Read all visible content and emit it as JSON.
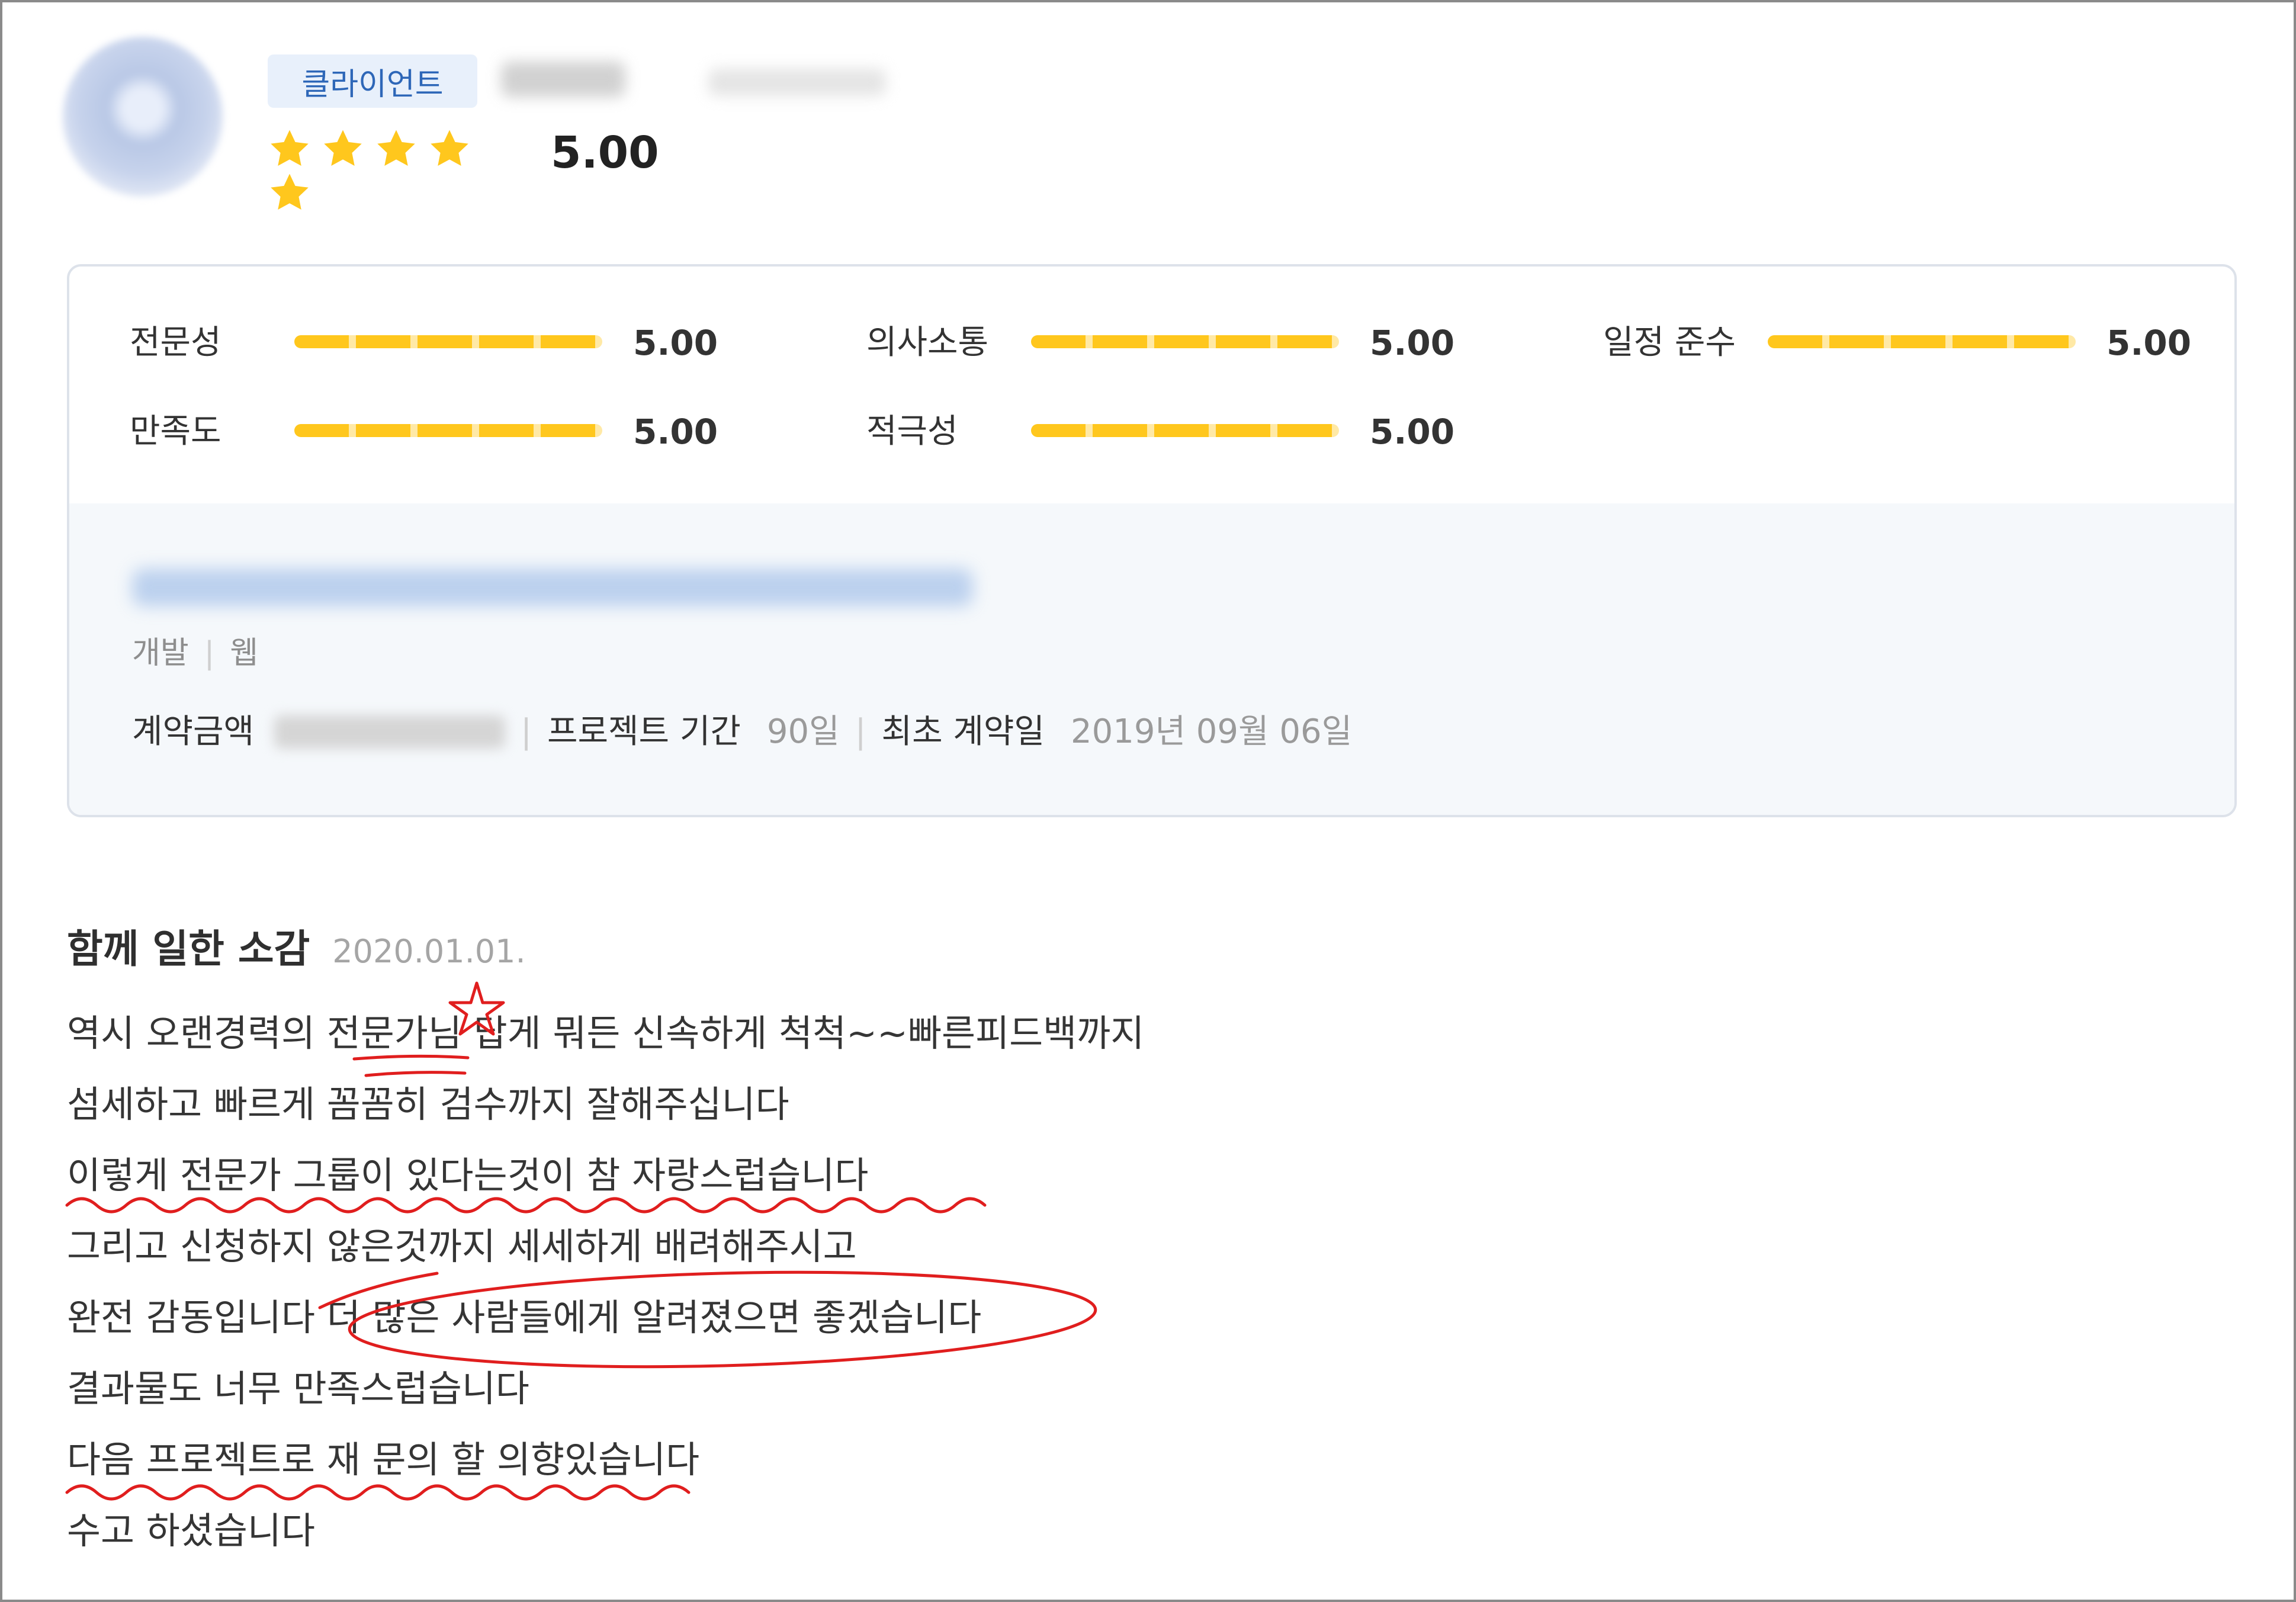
{
  "profile": {
    "role_badge": "클라이언트",
    "rating": "5.00",
    "stars_filled": 5,
    "stars_total": 5
  },
  "scores": [
    {
      "label": "전문성",
      "value": "5.00"
    },
    {
      "label": "의사소통",
      "value": "5.00"
    },
    {
      "label": "일정 준수",
      "value": "5.00"
    },
    {
      "label": "만족도",
      "value": "5.00"
    },
    {
      "label": "적극성",
      "value": "5.00"
    }
  ],
  "project": {
    "category": "개발",
    "subcategory": "웹",
    "amount_label": "계약금액",
    "period_label": "프로젝트 기간",
    "period_value": "90일",
    "first_contract_label": "최초 계약일",
    "first_contract_value": "2019년 09월 06일"
  },
  "review": {
    "title": "함께 일한 소감",
    "date": "2020.01.01.",
    "lines": [
      "역시 오랜경력의 전문가님 답게 뭐든 신속하게 척척~~빠른피드백까지",
      "섬세하고 빠르게 꼼꼼히 검수까지 잘해주십니다",
      "이렇게 전문가 그룹이 있다는것이 참 자랑스럽습니다",
      "그리고 신청하지 않은것까지 세세하게 배려해주시고",
      "완전 감동입니다 더 많은 사람들에게 알려졌으면 좋겠습니다",
      "결과물도 너무 만족스럽습니다",
      "다음 프로젝트로 재 문의 할 의향있습니다",
      "수고 하셨습니다"
    ]
  },
  "colors": {
    "star": "#ffc71d",
    "badge_bg": "#e8f0fb",
    "badge_text": "#2e67b8",
    "annotation": "#e01e1e"
  }
}
